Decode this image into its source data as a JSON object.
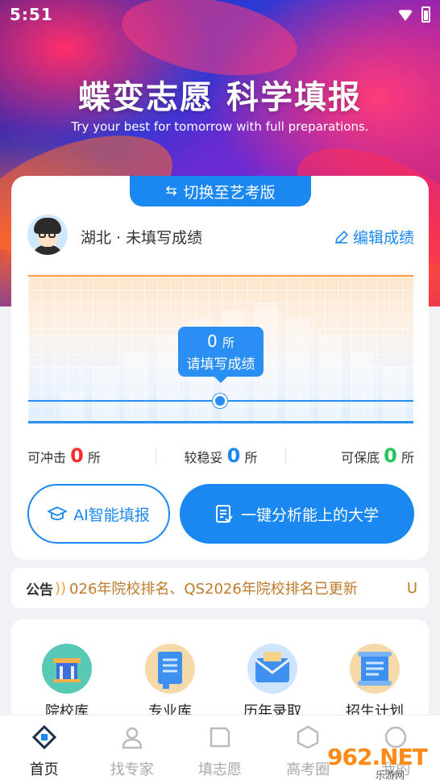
{
  "status_bar": {
    "time": "5:51"
  },
  "hero": {
    "title": "蝶变志愿 科学填报",
    "subtitle": "Try your best for tomorrow with full preparations."
  },
  "card": {
    "switch_label": "切换至艺考版",
    "switch_icon": "swap-icon",
    "user_line": "湖北 · 未填写成绩",
    "edit_label": "编辑成绩",
    "bubble": {
      "count": "0",
      "unit": "所",
      "hint": "请填写成绩"
    },
    "stats": [
      {
        "label": "可冲击",
        "value": "0",
        "unit": "所",
        "color": "#ff2d2d"
      },
      {
        "label": "较稳妥",
        "value": "0",
        "unit": "所",
        "color": "#1a88f0"
      },
      {
        "label": "可保底",
        "value": "0",
        "unit": "所",
        "color": "#22c55e"
      }
    ],
    "ai_button": "AI智能填报",
    "analyze_button": "一键分析能上的大学"
  },
  "notice": {
    "tag": "公告",
    "text": "026年院校排名、QS2026年院校排名已更新",
    "tail": "U"
  },
  "quick": [
    {
      "label": "院校库",
      "icon": "school-icon",
      "color": "#58c9b5"
    },
    {
      "label": "专业库",
      "icon": "book-icon",
      "color": "#f5c88a"
    },
    {
      "label": "历年录取",
      "icon": "mail-icon",
      "color": "#5aa8f5"
    },
    {
      "label": "招生计划",
      "icon": "scroll-icon",
      "color": "#f5c88a"
    }
  ],
  "tabbar": [
    {
      "label": "首页",
      "active": true
    },
    {
      "label": "找专家",
      "active": false
    },
    {
      "label": "填志愿",
      "active": false
    },
    {
      "label": "高考圈",
      "active": false
    },
    {
      "label": "我的",
      "active": false
    }
  ],
  "watermark": {
    "big": "962.NET",
    "small": "乐游网"
  }
}
